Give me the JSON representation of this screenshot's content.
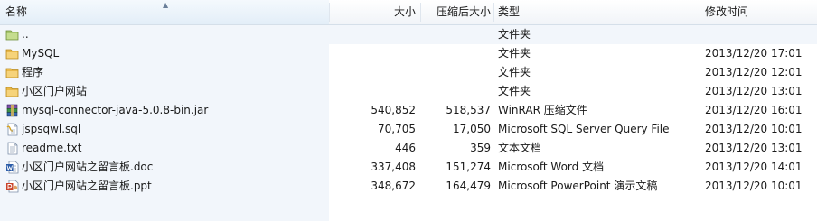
{
  "columns": {
    "name": "名称",
    "size": "大小",
    "packed": "压缩后大小",
    "type": "类型",
    "modified": "修改时间"
  },
  "rows": [
    {
      "icon": "parent-folder-icon",
      "name": "..",
      "size": "",
      "packed": "",
      "type": "文件夹",
      "modified": ""
    },
    {
      "icon": "folder-icon",
      "name": "MySQL",
      "size": "",
      "packed": "",
      "type": "文件夹",
      "modified": "2013/12/20 17:01"
    },
    {
      "icon": "folder-icon",
      "name": "程序",
      "size": "",
      "packed": "",
      "type": "文件夹",
      "modified": "2013/12/20 12:01"
    },
    {
      "icon": "folder-icon",
      "name": "小区门户网站",
      "size": "",
      "packed": "",
      "type": "文件夹",
      "modified": "2013/12/20 13:01"
    },
    {
      "icon": "winrar-archive-icon",
      "name": "mysql-connector-java-5.0.8-bin.jar",
      "size": "540,852",
      "packed": "518,537",
      "type": "WinRAR 压缩文件",
      "modified": "2013/12/20 16:01"
    },
    {
      "icon": "sql-file-icon",
      "name": "jspsqwl.sql",
      "size": "70,705",
      "packed": "17,050",
      "type": "Microsoft SQL Server Query File",
      "modified": "2013/12/20 10:01"
    },
    {
      "icon": "text-file-icon",
      "name": "readme.txt",
      "size": "446",
      "packed": "359",
      "type": "文本文档",
      "modified": "2013/12/20 13:01"
    },
    {
      "icon": "word-document-icon",
      "name": "小区门户网站之留言板.doc",
      "size": "337,408",
      "packed": "151,274",
      "type": "Microsoft Word 文档",
      "modified": "2013/12/20 14:01"
    },
    {
      "icon": "powerpoint-document-icon",
      "name": "小区门户网站之留言板.ppt",
      "size": "348,672",
      "packed": "164,479",
      "type": "Microsoft PowerPoint 演示文稿",
      "modified": "2013/12/20 10:01"
    }
  ]
}
